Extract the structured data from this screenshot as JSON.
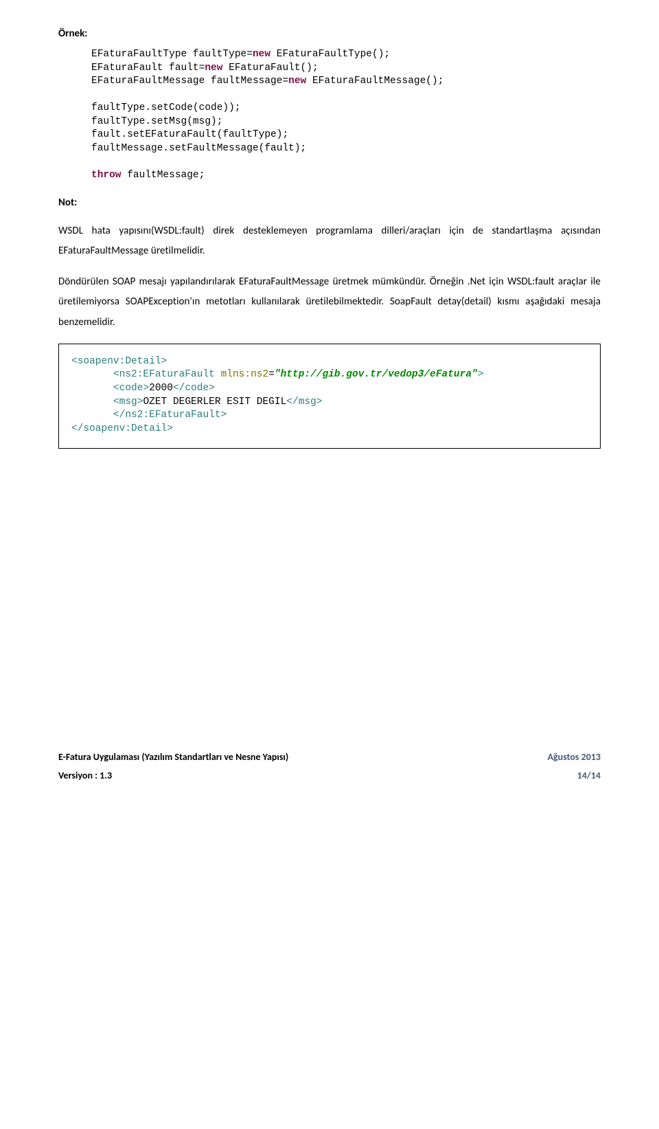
{
  "heading": "Örnek:",
  "code": {
    "l1a": "EFaturaFaultType faultType=",
    "l1kw": "new",
    "l1b": " EFaturaFaultType();",
    "l2a": "EFaturaFault fault=",
    "l2kw": "new",
    "l2b": " EFaturaFault();",
    "l3a": "EFaturaFaultMessage faultMessage=",
    "l3kw": "new",
    "l3b": " EFaturaFaultMessage();",
    "l4": "faultType.setCode(code));",
    "l5": "faultType.setMsg(msg);",
    "l6": "fault.setEFaturaFault(faultType);",
    "l7": "faultMessage.setFaultMessage(fault);",
    "l8kw": "throw",
    "l8b": " faultMessage;"
  },
  "not_label": "Not:",
  "para1": "WSDL hata yapısını(WSDL:fault) direk desteklemeyen programlama dilleri/araçları için de standartlaşma açısından EFaturaFaultMessage  üretilmelidir.",
  "para2": "Döndürülen SOAP mesajı yapılandırılarak EFaturaFaultMessage üretmek mümkündür. Örneğin .Net için WSDL:fault araçlar ile üretilemiyorsa SOAPException'ın metotları kullanılarak üretilebilmektedir. SoapFault detay(detail) kısmı aşağıdaki mesaja benzemelidir.",
  "xml": {
    "l1a": "<",
    "l1b": "soapenv:Detail",
    "l1c": ">",
    "l2a": "       <",
    "l2b": "ns2:EFaturaFault",
    "l2c": " ",
    "l2d": "mlns:ns2",
    "l2e": "=",
    "l2f": "\"http://gib.gov.tr/vedop3/eFatura\"",
    "l2g": ">",
    "l3a": "       <",
    "l3b": "code",
    "l3c": ">",
    "l3d": "2000",
    "l3e": "</",
    "l3f": "code",
    "l3g": ">",
    "l4a": "       <",
    "l4b": "msg",
    "l4c": ">",
    "l4d": "OZET DEGERLER ESIT DEGIL",
    "l4e": "</",
    "l4f": "msg",
    "l4g": ">",
    "l5a": "       </",
    "l5b": "ns2:EFaturaFault",
    "l5c": ">",
    "l6a": "</",
    "l6b": "soapenv:Detail",
    "l6c": ">"
  },
  "footer": {
    "left": "E-Fatura Uygulaması (Yazılım Standartları ve Nesne Yapısı)",
    "right": "Ağustos 2013",
    "version": "Versiyon : 1.3",
    "page": "14/14"
  }
}
